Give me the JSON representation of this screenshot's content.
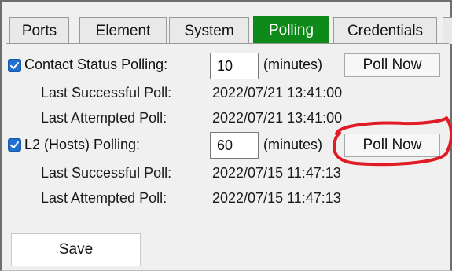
{
  "tabs": [
    {
      "label": "Ports",
      "active": false
    },
    {
      "label": "Element",
      "active": false
    },
    {
      "label": "System",
      "active": false
    },
    {
      "label": "Polling",
      "active": true
    },
    {
      "label": "Credentials",
      "active": false
    }
  ],
  "contact_polling": {
    "checked": true,
    "label": "Contact Status Polling:",
    "value": "10",
    "units": "(minutes)",
    "poll_button": "Poll Now",
    "last_successful_label": "Last Successful Poll:",
    "last_successful_value": "2022/07/21 13:41:00",
    "last_attempted_label": "Last Attempted Poll:",
    "last_attempted_value": "2022/07/21 13:41:00"
  },
  "l2_polling": {
    "checked": true,
    "label": "L2 (Hosts) Polling:",
    "value": "60",
    "units": "(minutes)",
    "poll_button": "Poll Now",
    "last_successful_label": "Last Successful Poll:",
    "last_successful_value": "2022/07/15 11:47:13",
    "last_attempted_label": "Last Attempted Poll:",
    "last_attempted_value": "2022/07/15 11:47:13"
  },
  "save_button": "Save",
  "colors": {
    "active_tab": "#0e8a1a",
    "checkbox": "#1f6fd1",
    "annotation": "#e01b24"
  }
}
